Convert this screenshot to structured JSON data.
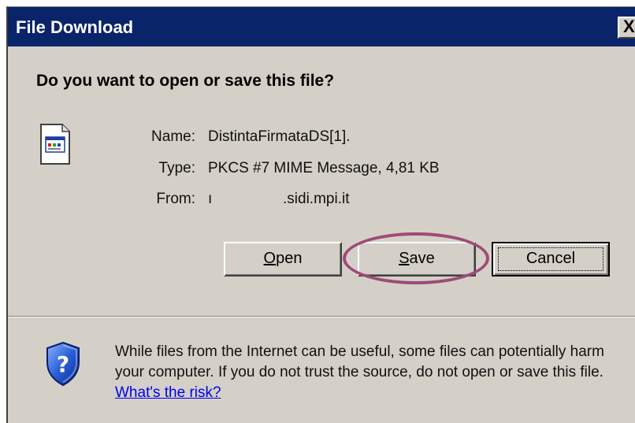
{
  "window": {
    "title": "File Download",
    "close_label": "X"
  },
  "prompt": {
    "heading": "Do you want to open or save this file?"
  },
  "file": {
    "icon": "document-icon",
    "name_label": "Name:",
    "name_value": "DistintaFirmataDS[1].",
    "type_label": "Type:",
    "type_value": "PKCS #7 MIME Message, 4,81 KB",
    "from_label": "From:",
    "from_value": "ı                 .sidi.mpi.it"
  },
  "buttons": {
    "open": {
      "mnemonic": "O",
      "rest": "pen"
    },
    "save": {
      "mnemonic": "S",
      "rest": "ave"
    },
    "cancel": "Cancel"
  },
  "annotation": {
    "color": "#a04a78"
  },
  "warning": {
    "icon": "shield-question-icon",
    "text": "While files from the Internet can be useful, some files can potentially harm your computer. If you do not trust the source, do not open or save this file. ",
    "link": "What's the risk?"
  },
  "colors": {
    "titlebar": "#0a246a",
    "face": "#d4d0c8",
    "link": "#0000ee"
  }
}
